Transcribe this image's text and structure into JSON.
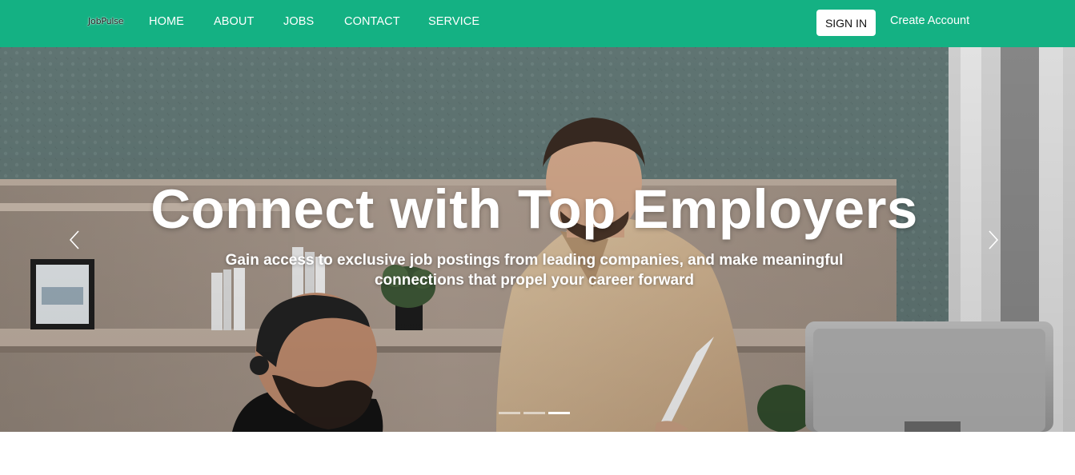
{
  "brand": {
    "logo_text": "JobPulse"
  },
  "nav": {
    "items": [
      {
        "label": "HOME"
      },
      {
        "label": "ABOUT"
      },
      {
        "label": "JOBS"
      },
      {
        "label": "CONTACT"
      },
      {
        "label": "SERVICE"
      }
    ],
    "sign_in_label": "SIGN IN",
    "create_account_label": "Create Account"
  },
  "hero": {
    "title": "Connect with Top Employers",
    "subtitle": "Gain access to exclusive job postings from leading companies, and make meaningful connections that propel your career forward",
    "slide_count": 3,
    "active_slide": 3,
    "prev_icon": "chevron-left-icon",
    "next_icon": "chevron-right-icon"
  },
  "colors": {
    "navbar": "#14b183",
    "text_on_nav": "#ffffff",
    "button_bg": "#ffffff"
  }
}
